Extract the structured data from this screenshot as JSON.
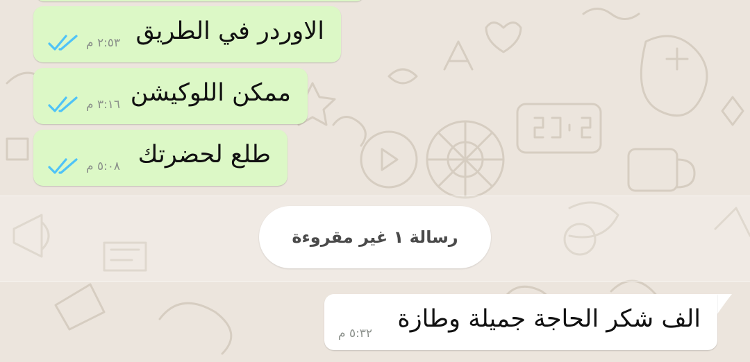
{
  "chat": {
    "messages": [
      {
        "direction": "outgoing",
        "text": "الاوردر في الطريق",
        "time": "٢:٥٣ م",
        "status": "read",
        "status_icon": "double-check-read-icon"
      },
      {
        "direction": "outgoing",
        "text": "ممكن اللوكيشن",
        "time": "٣:١٦ م",
        "status": "read",
        "status_icon": "double-check-read-icon"
      },
      {
        "direction": "outgoing",
        "text": "طلع لحضرتك",
        "time": "٥:٠٨ م",
        "status": "read",
        "status_icon": "double-check-read-icon"
      },
      {
        "direction": "incoming",
        "text": "الف شكر الحاجة جميلة وطازة",
        "time": "٥:٣٢ م"
      }
    ],
    "unread_divider": "رسالة ١ غير مقروءة"
  },
  "colors": {
    "wallpaper": "#ece5dd",
    "outgoing_bubble": "#dcf8c6",
    "incoming_bubble": "#ffffff",
    "read_check": "#4fc3f7",
    "time_text": "#8a8f8a"
  }
}
